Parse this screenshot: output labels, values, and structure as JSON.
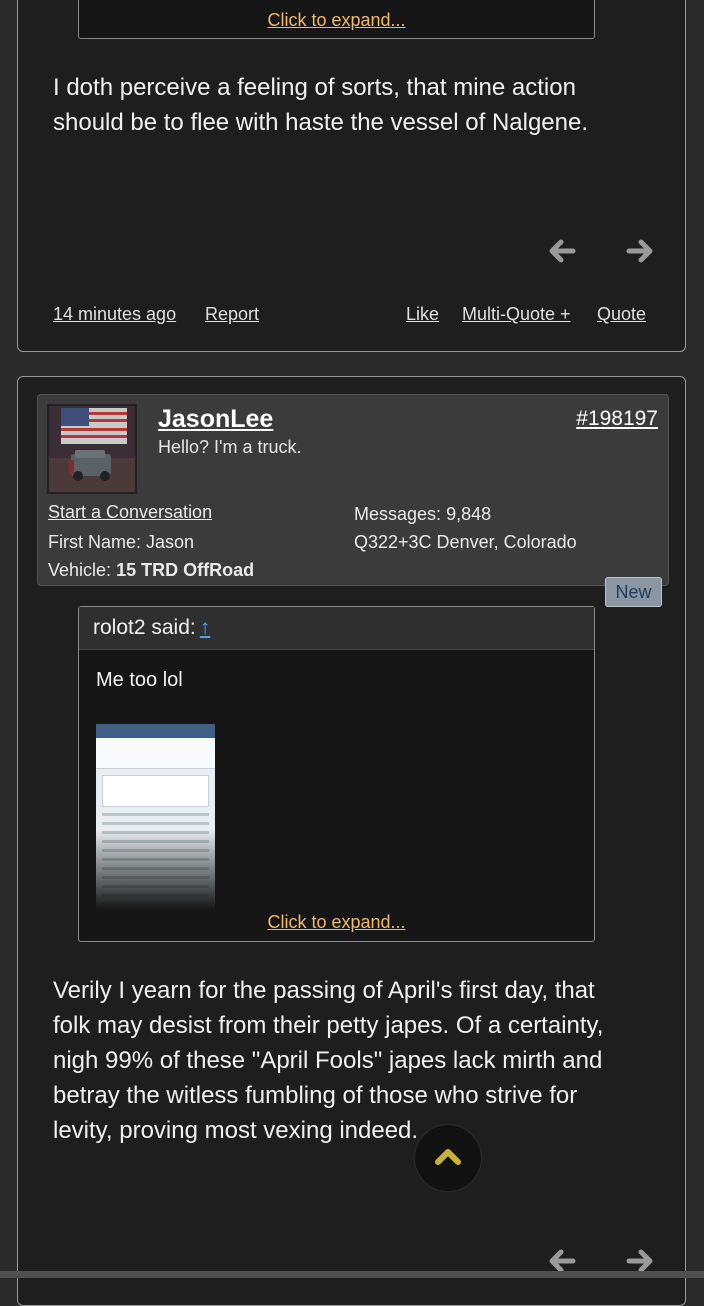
{
  "post1": {
    "expand_label": "Click to expand...",
    "text": "I doth perceive a feeling of sorts, that mine action should be to flee with haste the vessel of Nalgene.",
    "footer": {
      "time": "14 minutes ago",
      "report": "Report",
      "like": "Like",
      "multiquote": "Multi-Quote +",
      "quote": "Quote"
    }
  },
  "post2": {
    "user": {
      "username": "JasonLee",
      "title": "Hello? I'm a truck.",
      "start_conversation": "Start a Conversation",
      "first_name_label": "First Name:",
      "first_name": "Jason",
      "vehicle_label": "Vehicle:",
      "vehicle": "15 TRD OffRoad",
      "messages_label": "Messages:",
      "messages": "9,848",
      "location": "Q322+3C Denver, Colorado"
    },
    "post_number": "#198197",
    "badge": "New",
    "quote": {
      "author": "rolot2 said:",
      "up_arrow": "↑",
      "text": "Me too lol",
      "expand_label": "Click to expand..."
    },
    "text": "Verily I yearn for the passing of April's first day, that folk may desist from their petty japes. Of a certainty, nigh 99% of these \"April Fools\" japes lack mirth and betray the witless fumbling of those who strive for levity, proving most vexing indeed."
  },
  "icons": {
    "prev": "arrow-left-icon",
    "next": "arrow-right-icon",
    "scroll_top": "chevron-up-icon"
  },
  "colors": {
    "link_orange": "#f3b96a",
    "badge_bg": "#8a97a3",
    "up_arrow_blue": "#4aa3ff",
    "chevron_gold": "#c9b23a"
  }
}
